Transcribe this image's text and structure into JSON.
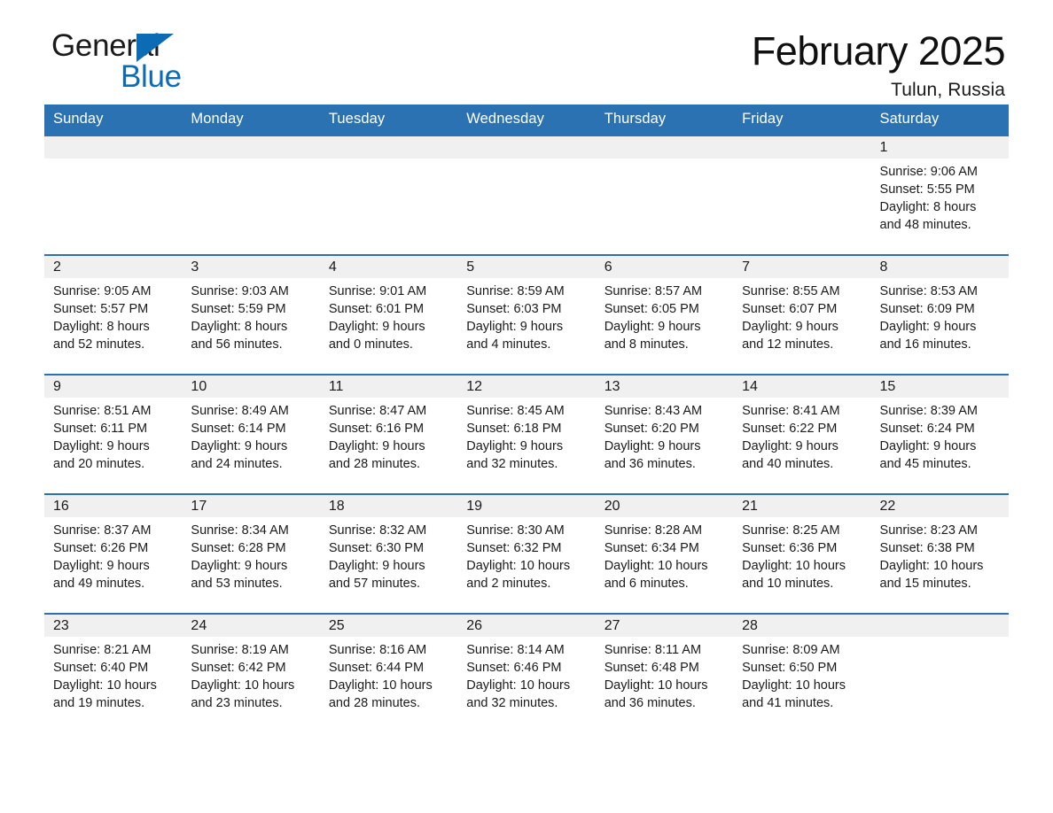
{
  "brand": {
    "word_one": "General",
    "word_two": "Blue",
    "triangle_icon": "triangle-icon",
    "accent_color": "#0b6cb5"
  },
  "header": {
    "month_title": "February 2025",
    "location": "Tulun, Russia"
  },
  "theme": {
    "header_blue": "#2b72b3",
    "band_gray": "#f0f0f0",
    "text": "#1a1a1a"
  },
  "calendar": {
    "weekday_headers": [
      "Sunday",
      "Monday",
      "Tuesday",
      "Wednesday",
      "Thursday",
      "Friday",
      "Saturday"
    ],
    "weeks": [
      [
        {
          "day": "",
          "blank": true,
          "sunrise": "",
          "sunset": "",
          "daylight_line1": "",
          "daylight_line2": ""
        },
        {
          "day": "",
          "blank": true,
          "sunrise": "",
          "sunset": "",
          "daylight_line1": "",
          "daylight_line2": ""
        },
        {
          "day": "",
          "blank": true,
          "sunrise": "",
          "sunset": "",
          "daylight_line1": "",
          "daylight_line2": ""
        },
        {
          "day": "",
          "blank": true,
          "sunrise": "",
          "sunset": "",
          "daylight_line1": "",
          "daylight_line2": ""
        },
        {
          "day": "",
          "blank": true,
          "sunrise": "",
          "sunset": "",
          "daylight_line1": "",
          "daylight_line2": ""
        },
        {
          "day": "",
          "blank": true,
          "sunrise": "",
          "sunset": "",
          "daylight_line1": "",
          "daylight_line2": ""
        },
        {
          "day": "1",
          "blank": false,
          "sunrise": "Sunrise: 9:06 AM",
          "sunset": "Sunset: 5:55 PM",
          "daylight_line1": "Daylight: 8 hours",
          "daylight_line2": "and 48 minutes."
        }
      ],
      [
        {
          "day": "2",
          "blank": false,
          "sunrise": "Sunrise: 9:05 AM",
          "sunset": "Sunset: 5:57 PM",
          "daylight_line1": "Daylight: 8 hours",
          "daylight_line2": "and 52 minutes."
        },
        {
          "day": "3",
          "blank": false,
          "sunrise": "Sunrise: 9:03 AM",
          "sunset": "Sunset: 5:59 PM",
          "daylight_line1": "Daylight: 8 hours",
          "daylight_line2": "and 56 minutes."
        },
        {
          "day": "4",
          "blank": false,
          "sunrise": "Sunrise: 9:01 AM",
          "sunset": "Sunset: 6:01 PM",
          "daylight_line1": "Daylight: 9 hours",
          "daylight_line2": "and 0 minutes."
        },
        {
          "day": "5",
          "blank": false,
          "sunrise": "Sunrise: 8:59 AM",
          "sunset": "Sunset: 6:03 PM",
          "daylight_line1": "Daylight: 9 hours",
          "daylight_line2": "and 4 minutes."
        },
        {
          "day": "6",
          "blank": false,
          "sunrise": "Sunrise: 8:57 AM",
          "sunset": "Sunset: 6:05 PM",
          "daylight_line1": "Daylight: 9 hours",
          "daylight_line2": "and 8 minutes."
        },
        {
          "day": "7",
          "blank": false,
          "sunrise": "Sunrise: 8:55 AM",
          "sunset": "Sunset: 6:07 PM",
          "daylight_line1": "Daylight: 9 hours",
          "daylight_line2": "and 12 minutes."
        },
        {
          "day": "8",
          "blank": false,
          "sunrise": "Sunrise: 8:53 AM",
          "sunset": "Sunset: 6:09 PM",
          "daylight_line1": "Daylight: 9 hours",
          "daylight_line2": "and 16 minutes."
        }
      ],
      [
        {
          "day": "9",
          "blank": false,
          "sunrise": "Sunrise: 8:51 AM",
          "sunset": "Sunset: 6:11 PM",
          "daylight_line1": "Daylight: 9 hours",
          "daylight_line2": "and 20 minutes."
        },
        {
          "day": "10",
          "blank": false,
          "sunrise": "Sunrise: 8:49 AM",
          "sunset": "Sunset: 6:14 PM",
          "daylight_line1": "Daylight: 9 hours",
          "daylight_line2": "and 24 minutes."
        },
        {
          "day": "11",
          "blank": false,
          "sunrise": "Sunrise: 8:47 AM",
          "sunset": "Sunset: 6:16 PM",
          "daylight_line1": "Daylight: 9 hours",
          "daylight_line2": "and 28 minutes."
        },
        {
          "day": "12",
          "blank": false,
          "sunrise": "Sunrise: 8:45 AM",
          "sunset": "Sunset: 6:18 PM",
          "daylight_line1": "Daylight: 9 hours",
          "daylight_line2": "and 32 minutes."
        },
        {
          "day": "13",
          "blank": false,
          "sunrise": "Sunrise: 8:43 AM",
          "sunset": "Sunset: 6:20 PM",
          "daylight_line1": "Daylight: 9 hours",
          "daylight_line2": "and 36 minutes."
        },
        {
          "day": "14",
          "blank": false,
          "sunrise": "Sunrise: 8:41 AM",
          "sunset": "Sunset: 6:22 PM",
          "daylight_line1": "Daylight: 9 hours",
          "daylight_line2": "and 40 minutes."
        },
        {
          "day": "15",
          "blank": false,
          "sunrise": "Sunrise: 8:39 AM",
          "sunset": "Sunset: 6:24 PM",
          "daylight_line1": "Daylight: 9 hours",
          "daylight_line2": "and 45 minutes."
        }
      ],
      [
        {
          "day": "16",
          "blank": false,
          "sunrise": "Sunrise: 8:37 AM",
          "sunset": "Sunset: 6:26 PM",
          "daylight_line1": "Daylight: 9 hours",
          "daylight_line2": "and 49 minutes."
        },
        {
          "day": "17",
          "blank": false,
          "sunrise": "Sunrise: 8:34 AM",
          "sunset": "Sunset: 6:28 PM",
          "daylight_line1": "Daylight: 9 hours",
          "daylight_line2": "and 53 minutes."
        },
        {
          "day": "18",
          "blank": false,
          "sunrise": "Sunrise: 8:32 AM",
          "sunset": "Sunset: 6:30 PM",
          "daylight_line1": "Daylight: 9 hours",
          "daylight_line2": "and 57 minutes."
        },
        {
          "day": "19",
          "blank": false,
          "sunrise": "Sunrise: 8:30 AM",
          "sunset": "Sunset: 6:32 PM",
          "daylight_line1": "Daylight: 10 hours",
          "daylight_line2": "and 2 minutes."
        },
        {
          "day": "20",
          "blank": false,
          "sunrise": "Sunrise: 8:28 AM",
          "sunset": "Sunset: 6:34 PM",
          "daylight_line1": "Daylight: 10 hours",
          "daylight_line2": "and 6 minutes."
        },
        {
          "day": "21",
          "blank": false,
          "sunrise": "Sunrise: 8:25 AM",
          "sunset": "Sunset: 6:36 PM",
          "daylight_line1": "Daylight: 10 hours",
          "daylight_line2": "and 10 minutes."
        },
        {
          "day": "22",
          "blank": false,
          "sunrise": "Sunrise: 8:23 AM",
          "sunset": "Sunset: 6:38 PM",
          "daylight_line1": "Daylight: 10 hours",
          "daylight_line2": "and 15 minutes."
        }
      ],
      [
        {
          "day": "23",
          "blank": false,
          "sunrise": "Sunrise: 8:21 AM",
          "sunset": "Sunset: 6:40 PM",
          "daylight_line1": "Daylight: 10 hours",
          "daylight_line2": "and 19 minutes."
        },
        {
          "day": "24",
          "blank": false,
          "sunrise": "Sunrise: 8:19 AM",
          "sunset": "Sunset: 6:42 PM",
          "daylight_line1": "Daylight: 10 hours",
          "daylight_line2": "and 23 minutes."
        },
        {
          "day": "25",
          "blank": false,
          "sunrise": "Sunrise: 8:16 AM",
          "sunset": "Sunset: 6:44 PM",
          "daylight_line1": "Daylight: 10 hours",
          "daylight_line2": "and 28 minutes."
        },
        {
          "day": "26",
          "blank": false,
          "sunrise": "Sunrise: 8:14 AM",
          "sunset": "Sunset: 6:46 PM",
          "daylight_line1": "Daylight: 10 hours",
          "daylight_line2": "and 32 minutes."
        },
        {
          "day": "27",
          "blank": false,
          "sunrise": "Sunrise: 8:11 AM",
          "sunset": "Sunset: 6:48 PM",
          "daylight_line1": "Daylight: 10 hours",
          "daylight_line2": "and 36 minutes."
        },
        {
          "day": "28",
          "blank": false,
          "sunrise": "Sunrise: 8:09 AM",
          "sunset": "Sunset: 6:50 PM",
          "daylight_line1": "Daylight: 10 hours",
          "daylight_line2": "and 41 minutes."
        },
        {
          "day": "",
          "blank": true,
          "sunrise": "",
          "sunset": "",
          "daylight_line1": "",
          "daylight_line2": ""
        }
      ]
    ]
  }
}
